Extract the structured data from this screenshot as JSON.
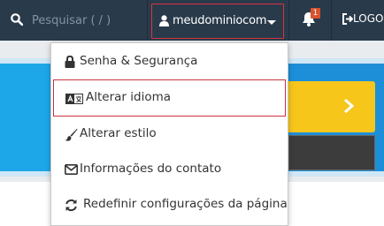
{
  "search": {
    "placeholder": "Pesquisar ( / )",
    "icon": "search-icon"
  },
  "user": {
    "username": "meudominiocom",
    "icon": "user-icon"
  },
  "notifications": {
    "count": "1",
    "icon": "bell-icon"
  },
  "logout": {
    "label": "LOGO",
    "icon": "logout-icon"
  },
  "menu": {
    "items": [
      {
        "label": "Senha & Segurança",
        "icon": "lock-icon"
      },
      {
        "label": "Alterar idioma",
        "icon": "language-icon"
      },
      {
        "label": "Alterar estilo",
        "icon": "paintbrush-icon"
      },
      {
        "label": "Informações do contato",
        "icon": "envelope-icon"
      },
      {
        "label": "Redefinir configurações da página",
        "icon": "refresh-icon"
      }
    ]
  },
  "colors": {
    "topbar": "#293a4a",
    "highlight_border": "#c8333c",
    "badge": "#d9522c",
    "banner_blue": "#1da7e8",
    "panel_yellow": "#f7c61b"
  }
}
